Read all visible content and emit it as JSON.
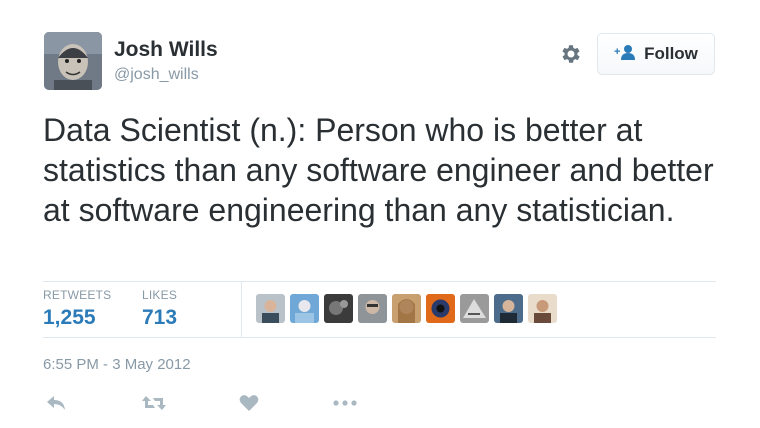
{
  "author": {
    "name": "Josh Wills",
    "handle": "@josh_wills",
    "avatar": "avatar"
  },
  "header": {
    "gear_icon": "gear-icon",
    "follow_label": "Follow",
    "follow_icon": "follow-user-icon"
  },
  "tweet": {
    "text": "Data Scientist (n.): Person who is better at statistics than any software engineer and better at software engineering than any statistician."
  },
  "stats": {
    "retweets_label": "RETWEETS",
    "retweets_count": "1,255",
    "likes_label": "LIKES",
    "likes_count": "713",
    "liker_avatars": [
      "liker-avatar",
      "liker-avatar",
      "liker-avatar",
      "liker-avatar",
      "liker-avatar",
      "liker-avatar",
      "liker-avatar",
      "liker-avatar",
      "liker-avatar"
    ]
  },
  "timestamp": "6:55 PM - 3 May 2012",
  "actions": [
    "reply-icon",
    "retweet-icon",
    "like-icon",
    "more-icon"
  ],
  "colors": {
    "link_blue": "#2b7bb9",
    "muted_gray": "#8899a6",
    "text": "#292f33",
    "icon_gray": "#aab8c2",
    "border": "#e1e8ed"
  }
}
